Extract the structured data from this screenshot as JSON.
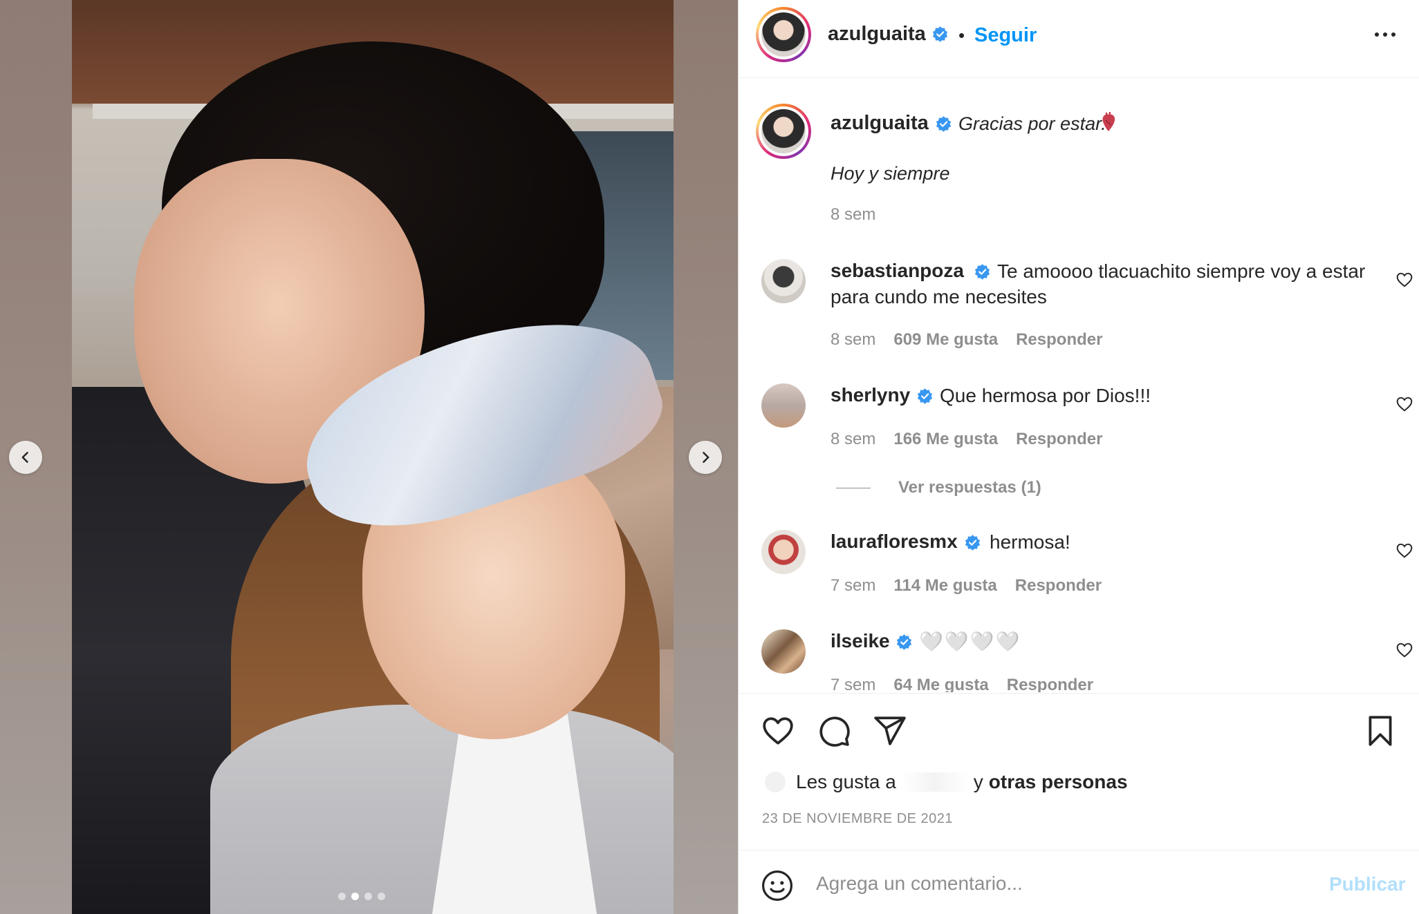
{
  "post": {
    "author": "azulguaita",
    "follow_label": "Seguir",
    "separator": "•",
    "caption_line1": "Gracias por estar.",
    "caption_line2": "Hoy y siempre",
    "caption_time": "8 sem",
    "carousel": {
      "total_slides": 4,
      "active_slide": 2
    }
  },
  "comments": [
    {
      "user": "sebastianpoza",
      "verified": true,
      "text": "Te amoooo tlacuachito siempre voy a estar para cundo me necesites",
      "time": "8 sem",
      "likes": "609 Me gusta",
      "reply": "Responder"
    },
    {
      "user": "sherlyny",
      "verified": true,
      "text": "Que hermosa por Dios!!!",
      "time": "8 sem",
      "likes": "166 Me gusta",
      "reply": "Responder",
      "view_replies": "Ver respuestas (1)"
    },
    {
      "user": "laurafloresmx",
      "verified": true,
      "text": "hermosa!",
      "time": "7 sem",
      "likes": "114 Me gusta",
      "reply": "Responder"
    },
    {
      "user": "ilseike",
      "verified": true,
      "text": "🤍🤍🤍🤍",
      "time": "7 sem",
      "likes": "64 Me gusta",
      "reply": "Responder"
    }
  ],
  "footer": {
    "likes_prefix": "Les gusta a",
    "likes_middle": "y",
    "likes_suffix": "otras personas",
    "date": "23 DE NOVIEMBRE DE 2021",
    "comment_placeholder": "Agrega un comentario...",
    "publish_label": "Publicar"
  },
  "icons": {
    "verified": "verified-badge-icon",
    "more": "more-options-icon",
    "like": "heart-icon",
    "comment": "comment-icon",
    "share": "share-icon",
    "save": "bookmark-icon",
    "emoji": "emoji-icon"
  },
  "colors": {
    "accent": "#0095f6",
    "muted": "#8e8e8e",
    "publish_disabled": "#b2dffc",
    "verified": "#3897f0"
  }
}
